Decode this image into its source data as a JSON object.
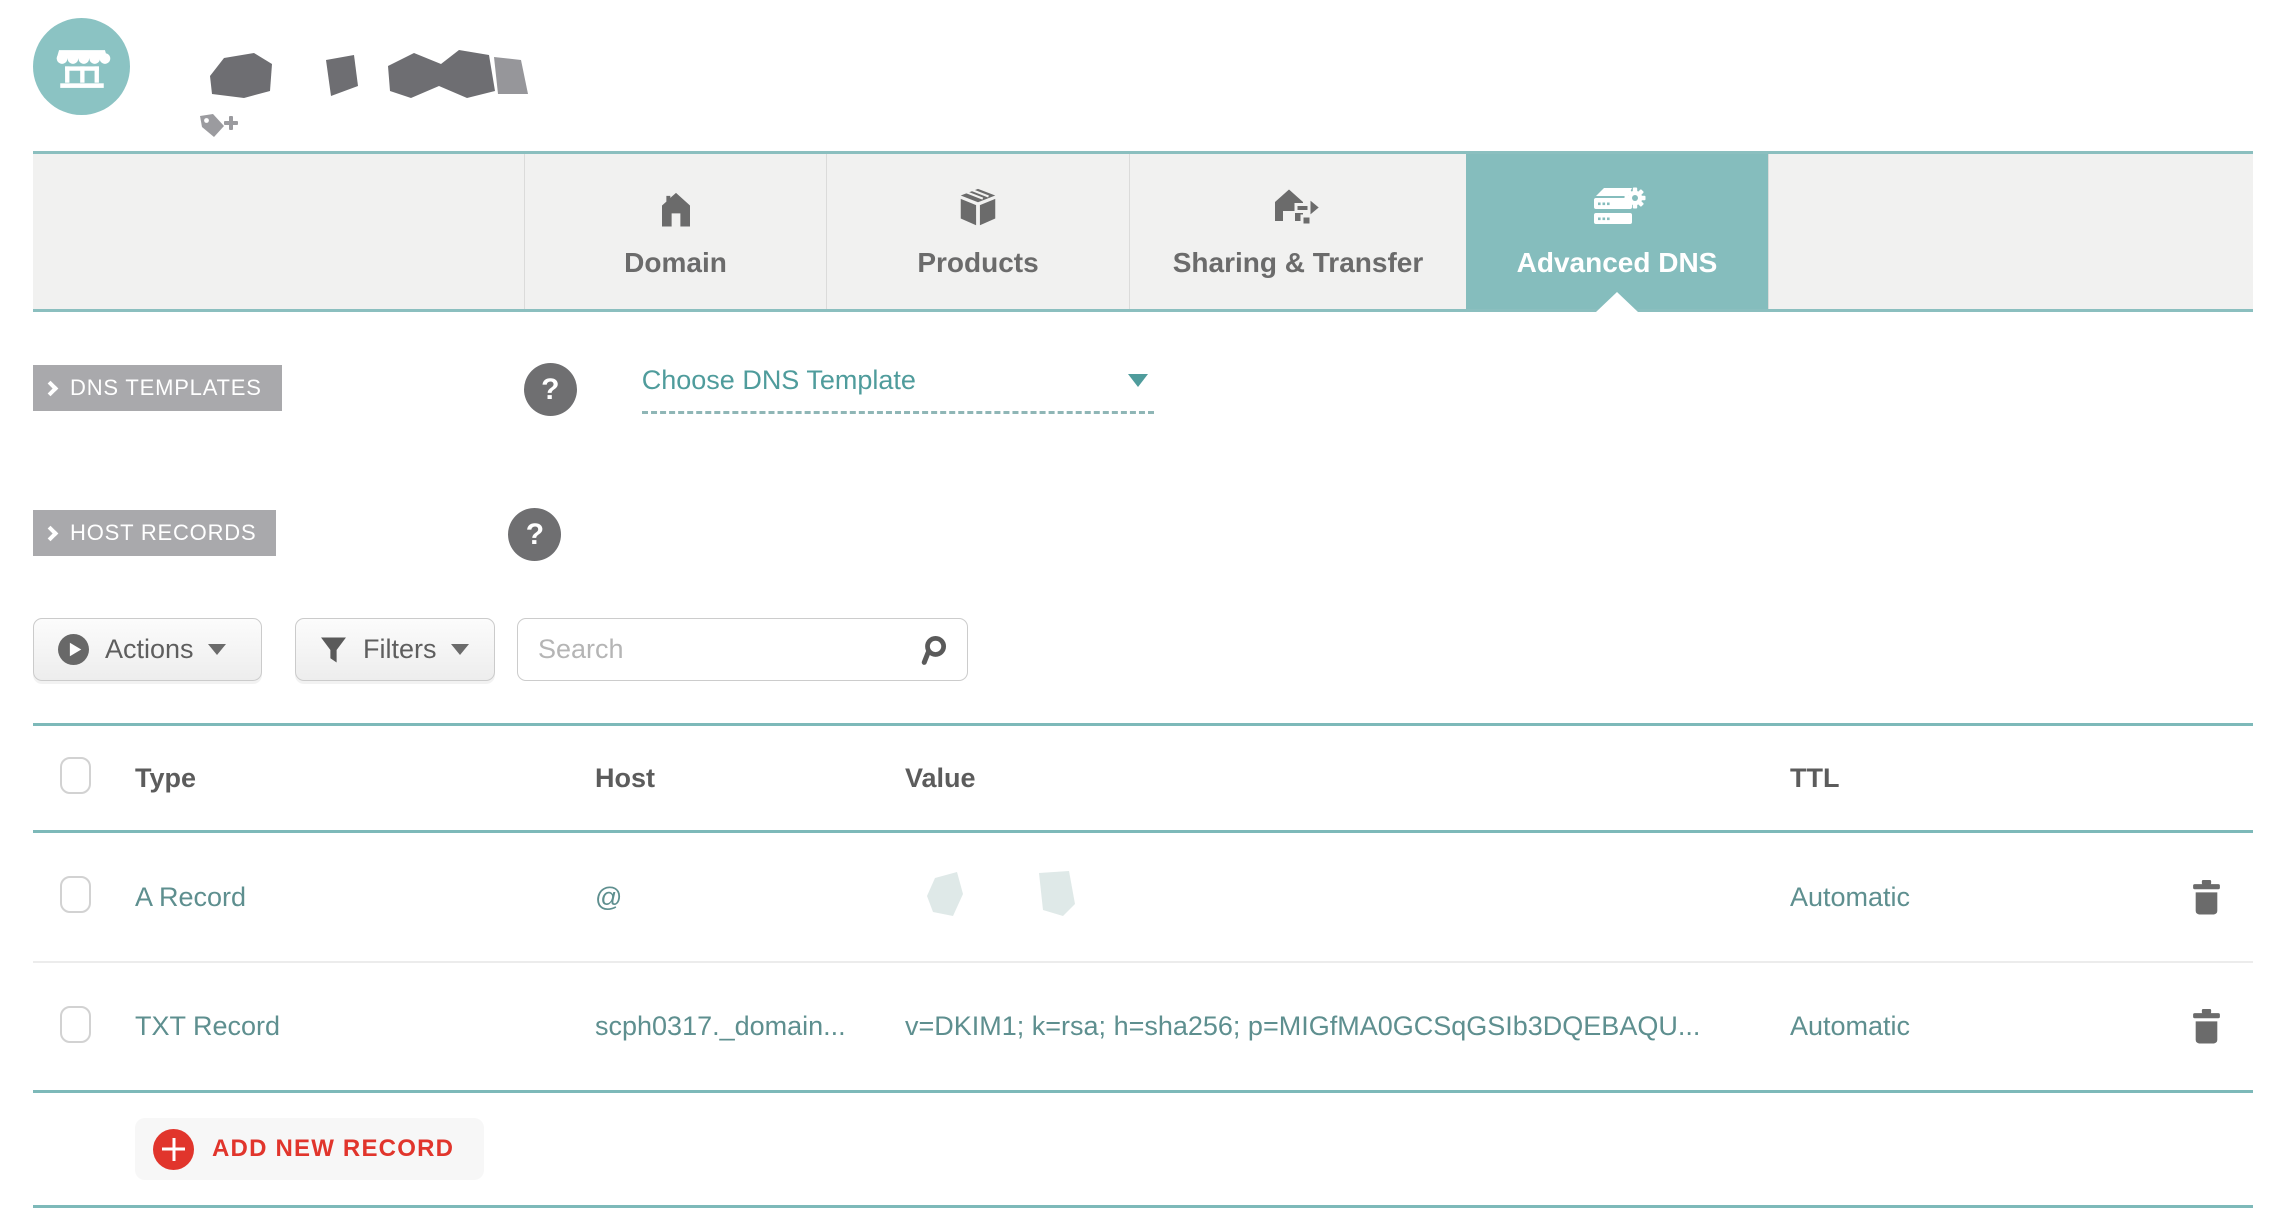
{
  "header": {
    "avatar_icon": "storefront-icon",
    "domain_name_redacted": true,
    "tag_icon": "tag-plus-icon"
  },
  "tabs": [
    {
      "label": "Domain",
      "icon": "house-icon",
      "active": false
    },
    {
      "label": "Products",
      "icon": "box-icon",
      "active": false
    },
    {
      "label": "Sharing & Transfer",
      "icon": "house-transfer-icon",
      "active": false
    },
    {
      "label": "Advanced DNS",
      "icon": "dns-server-gear-icon",
      "active": true
    }
  ],
  "sections": {
    "dns_templates": {
      "badge": "DNS TEMPLATES",
      "help": "?",
      "dropdown_label": "Choose DNS Template"
    },
    "host_records": {
      "badge": "HOST RECORDS",
      "help": "?"
    }
  },
  "toolbar": {
    "actions_label": "Actions",
    "filters_label": "Filters",
    "search_placeholder": "Search"
  },
  "table": {
    "headers": {
      "type": "Type",
      "host": "Host",
      "value": "Value",
      "ttl": "TTL"
    },
    "rows": [
      {
        "type": "A Record",
        "host": "@",
        "value": "",
        "value_redacted": true,
        "ttl": "Automatic"
      },
      {
        "type": "TXT Record",
        "host": "scph0317._domain...",
        "value": "v=DKIM1; k=rsa; h=sha256; p=MIGfMA0GCSqGSIb3DQEBAQU...",
        "value_redacted": false,
        "ttl": "Automatic"
      }
    ]
  },
  "footer": {
    "add_record_label": "ADD NEW RECORD"
  },
  "colors": {
    "accent_teal": "#85BDBD",
    "teal_border": "#7DB9B9",
    "teal_text": "#5E8F8F",
    "teal_link": "#4F9C9C",
    "badge_gray": "#A9A9AC",
    "icon_gray": "#6B6B6B",
    "tabbar_bg": "#F1F1F0",
    "danger_red": "#E1352C"
  }
}
